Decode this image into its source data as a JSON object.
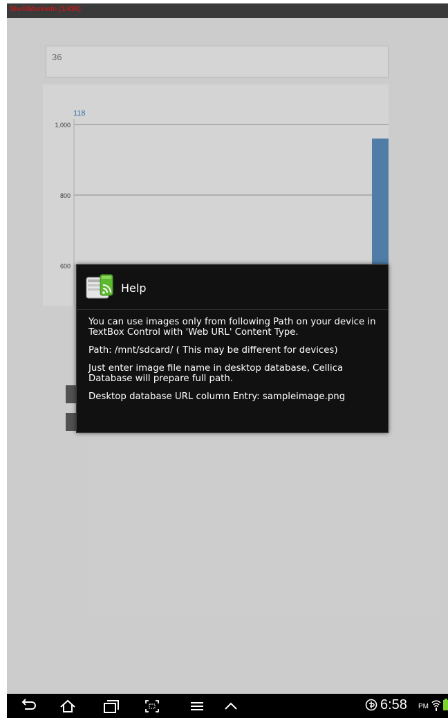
{
  "app": {
    "title": "Shell/Markinfo [1/439]"
  },
  "field": {
    "value": "36"
  },
  "chart_data": {
    "type": "bar",
    "annotation": "118",
    "y_ticks": [
      "1,000",
      "800",
      "600"
    ],
    "ylim": [
      450,
      1050
    ],
    "values": [
      960
    ]
  },
  "dialog": {
    "title": "Help",
    "paragraphs": [
      "You can use images only from following Path on your device in TextBox Control with 'Web URL' Content Type.",
      "Path: /mnt/sdcard/ ( This may be different for devices)",
      "Just enter image file name in desktop database, Cellica Database will prepare full path.",
      "Desktop database URL column Entry: sampleimage.png"
    ]
  },
  "statusbar": {
    "time": "6:58",
    "ampm": "PM"
  },
  "nav": {
    "icons": [
      "back-icon",
      "home-icon",
      "recent-apps-icon",
      "screenshot-icon",
      "menu-icon",
      "chevron-up-icon"
    ]
  },
  "colors": {
    "accent": "#3a7fc0",
    "bar": "#5b8fbf",
    "dialog_bg": "#111111"
  }
}
